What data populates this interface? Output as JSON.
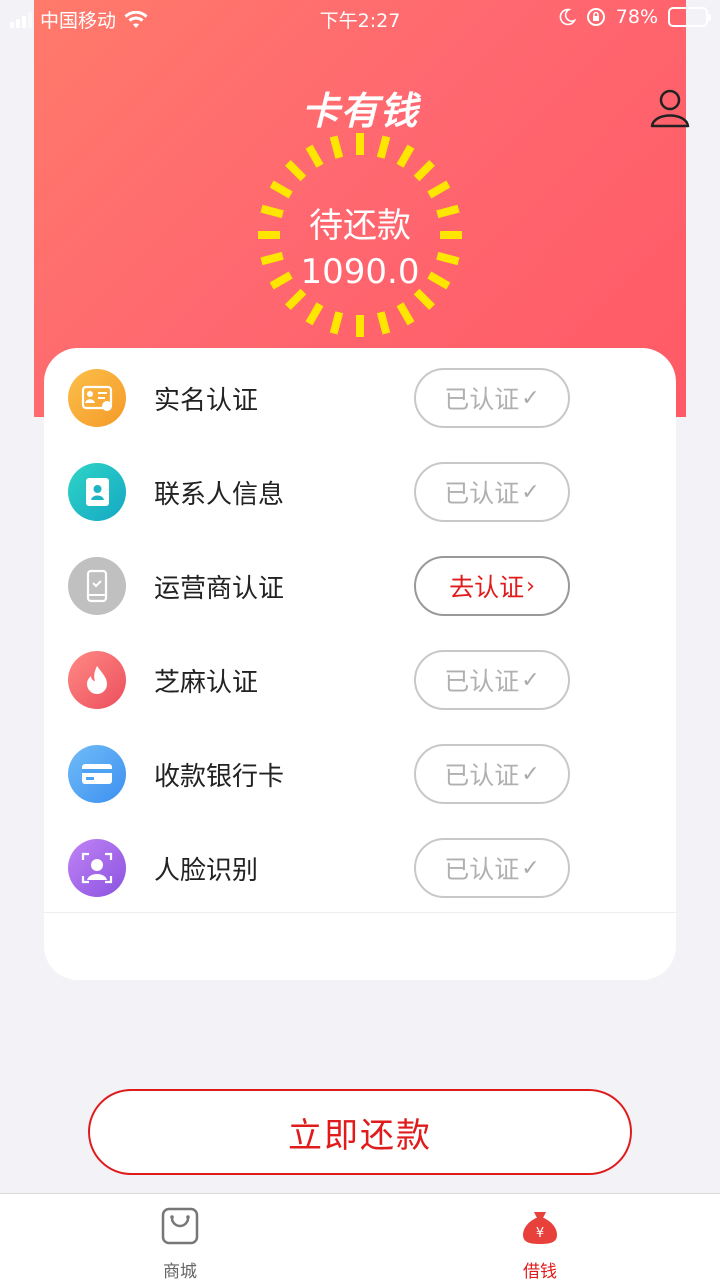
{
  "status_bar": {
    "carrier": "中国移动",
    "time": "下午2:27",
    "battery": "78%",
    "battery_level": 0.78
  },
  "header": {
    "logo_text": "卡有钱",
    "ring_label": "待还款",
    "amount": "1090.0"
  },
  "verification_items": [
    {
      "label": "实名认证",
      "status": "已认证",
      "state": "done",
      "icon": "id-card-icon",
      "color": "#f9a937"
    },
    {
      "label": "联系人信息",
      "status": "已认证",
      "state": "done",
      "icon": "contact-book-icon",
      "color": "#1fc0c4"
    },
    {
      "label": "运营商认证",
      "status": "去认证",
      "state": "pending",
      "icon": "phone-icon",
      "color": "#bbbbbb"
    },
    {
      "label": "芝麻认证",
      "status": "已认证",
      "state": "done",
      "icon": "sesame-icon",
      "color": "#f05b64"
    },
    {
      "label": "收款银行卡",
      "status": "已认证",
      "state": "done",
      "icon": "bank-card-icon",
      "color": "#4ea3f5"
    },
    {
      "label": "人脸识别",
      "status": "已认证",
      "state": "done",
      "icon": "face-icon",
      "color": "#a66ce8"
    }
  ],
  "repay_button": "立即还款",
  "tabbar": {
    "shop": "商城",
    "borrow": "借钱",
    "active": "borrow",
    "accent": "#e01b1b"
  }
}
